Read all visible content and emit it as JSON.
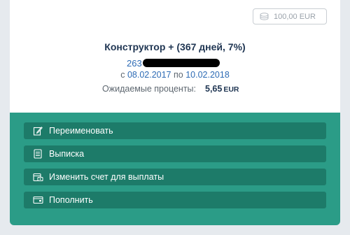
{
  "deposit": {
    "balance": "100,00 EUR",
    "title": "Конструктор + (367 дней, 7%)",
    "account_prefix": "263",
    "period": {
      "from_word": "с",
      "from_date": "08.02.2017",
      "to_word": "по",
      "to_date": "10.02.2018"
    },
    "interest": {
      "label": "Ожидаемые проценты:",
      "amount": "5,65",
      "currency": "EUR"
    }
  },
  "actions": [
    {
      "label": "Переименовать",
      "icon": "edit-icon"
    },
    {
      "label": "Выписка",
      "icon": "document-icon"
    },
    {
      "label": "Изменить счет для выплаты",
      "icon": "change-account-icon"
    },
    {
      "label": "Пополнить",
      "icon": "wallet-icon"
    }
  ],
  "colors": {
    "title": "#1f3552",
    "link": "#2d6bb5",
    "panel": "#2b9c87",
    "button": "#1d7b69"
  }
}
